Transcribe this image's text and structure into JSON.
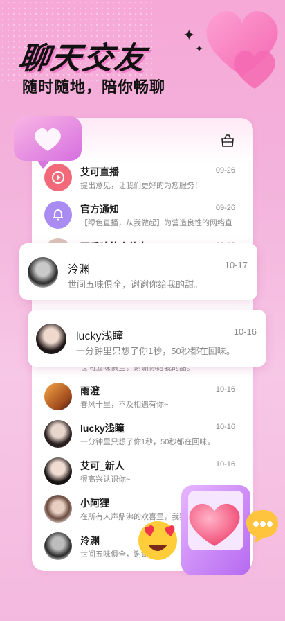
{
  "header": {
    "title": "聊天交友",
    "subtitle": "随时随地，陪你畅聊"
  },
  "colors": {
    "accent": "#f0479a",
    "system_red": "#f26a7a",
    "system_purple": "#a98bf2"
  },
  "messages": [
    {
      "name": "艾可直播",
      "date": "09-26",
      "preview": "提出意见，让我们更好的为您服务！",
      "avatar": "play-icon"
    },
    {
      "name": "官方通知",
      "date": "09-26",
      "preview": "【绿色直播，从我做起】为营造良性的网络直…",
      "avatar": "bell-icon"
    },
    {
      "name": "可乐味的小仙女",
      "date": "10-18",
      "preview": "",
      "avatar": "photo"
    },
    {
      "name": "",
      "date": "",
      "preview": "世间五味俱全，谢谢你给我的甜。",
      "avatar": "photo"
    },
    {
      "name": "雨澄",
      "date": "10-16",
      "preview": "春风十里，不及相遇有你~",
      "avatar": "photo"
    },
    {
      "name": "lucky浅瞳",
      "date": "10-16",
      "preview": "一分钟里只想了你1秒，50秒都在回味。",
      "avatar": "photo"
    },
    {
      "name": "艾可_新人",
      "date": "10-16",
      "preview": "很高兴认识你~",
      "avatar": "photo"
    },
    {
      "name": "小阿狸",
      "date": "",
      "preview": "在所有人声鼎沸的欢喜里，我独",
      "avatar": "photo"
    },
    {
      "name": "泠渊",
      "date": "",
      "preview": "世间五味俱全，谢谢",
      "avatar": "photo"
    }
  ],
  "highlights": [
    {
      "name": "泠渊",
      "date": "10-17",
      "preview": "世间五味俱全，谢谢你给我的甜。"
    },
    {
      "name": "lucky浅瞳",
      "date": "10-16",
      "preview": "一分钟里只想了你1秒，50秒都在回味。"
    }
  ],
  "toolbar": {
    "shop_icon": "shop-icon"
  }
}
